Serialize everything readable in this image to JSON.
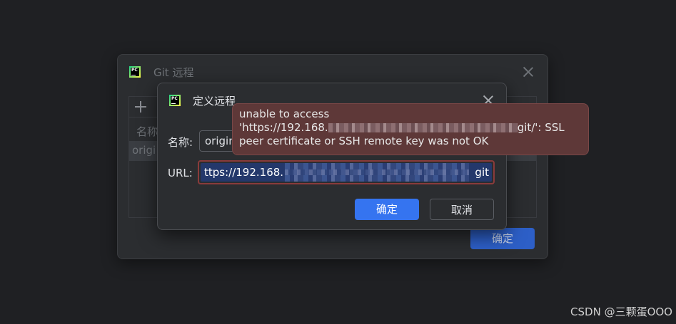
{
  "back_dialog": {
    "title": "Git 远程",
    "column_header": "名称",
    "remote_row_name": "origi",
    "ok_label": "确定"
  },
  "front_dialog": {
    "title": "定义远程",
    "name_label": "名称:",
    "name_value": "origin",
    "url_label": "URL:",
    "url_prefix": "ttps://192.168.",
    "url_suffix": "git",
    "ok_label": "确定",
    "cancel_label": "取消"
  },
  "error_tooltip": {
    "line1": "unable to access",
    "line2_prefix": "'https://192.168.",
    "line2_suffix": "git/': SSL",
    "line3": "peer certificate or SSH remote key was not OK"
  },
  "watermark": "CSDN @三颗蛋OOO",
  "icons": {
    "app_logo": "pycharm-logo-icon",
    "close": "close-icon",
    "add": "plus-icon"
  },
  "colors": {
    "background": "#1f2023",
    "dialog": "#2b2d30",
    "primary_button": "#3574f0",
    "error_tooltip": "#5e3838",
    "error_border": "#8a3b3b"
  }
}
